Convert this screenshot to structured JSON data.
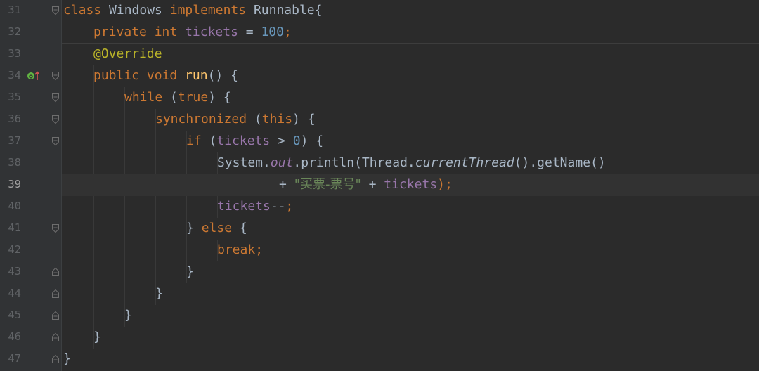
{
  "colors": {
    "background": "#2b2b2b",
    "gutter": "#313335",
    "keyword": "#cc7832",
    "number": "#6897bb",
    "annotation": "#bbb529",
    "field": "#9876aa",
    "method": "#ffc66d",
    "string": "#6a8759",
    "default": "#a9b7c6"
  },
  "gutter": {
    "line_numbers": [
      "31",
      "32",
      "33",
      "34",
      "35",
      "36",
      "37",
      "38",
      "39",
      "40",
      "41",
      "42",
      "43",
      "44",
      "45",
      "46",
      "47"
    ],
    "current_line": "39",
    "override_marker_icon": "override-method-icon",
    "fold_icons": [
      "fold-open-icon",
      "fold-close-icon"
    ]
  },
  "code": {
    "l31": {
      "kw_class": "class",
      "name": " Windows ",
      "kw_impl": "implements",
      "iface": " Runnable{"
    },
    "l32": {
      "kw_private": "private ",
      "kw_int": "int ",
      "field": "tickets",
      "eq": " = ",
      "num": "100",
      "semi": ";"
    },
    "l33": {
      "annotation": "@Override"
    },
    "l34": {
      "kw_public": "public ",
      "kw_void": "void ",
      "method": "run",
      "rest": "() {"
    },
    "l35": {
      "kw_while": "while ",
      "open": "(",
      "kw_true": "true",
      "close": ") {"
    },
    "l36": {
      "kw_sync": "synchronized ",
      "open": "(",
      "kw_this": "this",
      "close": ") {"
    },
    "l37": {
      "kw_if": "if ",
      "open": "(",
      "field": "tickets",
      "gt": " > ",
      "num": "0",
      "close": ") {"
    },
    "l38": {
      "sys": "System.",
      "out": "out",
      "println": ".println(Thread.",
      "current": "currentThread",
      "rest": "().getName()"
    },
    "l39": {
      "plus": "+ ",
      "str": "\"买票-票号\"",
      "plus2": " + ",
      "field": "tickets",
      "semi": ");"
    },
    "l40": {
      "field": "tickets",
      "op": "--",
      "semi": ";"
    },
    "l41": {
      "brace": "} ",
      "kw_else": "else",
      "open": " {"
    },
    "l42": {
      "kw_break": "break",
      "semi": ";"
    },
    "l43": {
      "brace": "}"
    },
    "l44": {
      "brace": "}"
    },
    "l45": {
      "brace": "}"
    },
    "l46": {
      "brace": "}"
    },
    "l47": {
      "brace": "}"
    }
  }
}
